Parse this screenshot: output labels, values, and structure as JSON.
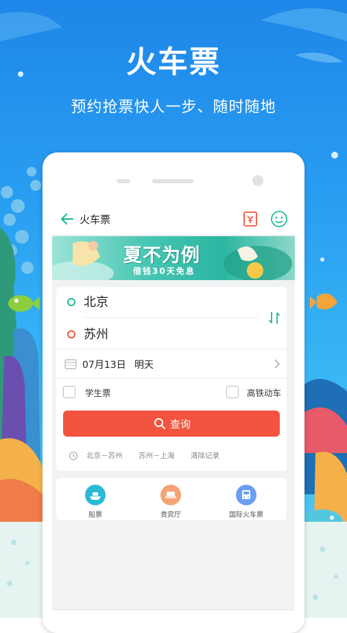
{
  "promo": {
    "title": "火车票",
    "subtitle": "预约抢票快人一步、随时随地"
  },
  "appbar": {
    "title": "火车票",
    "icons": [
      "back-arrow-icon",
      "ticket-icon",
      "customer-service-icon"
    ]
  },
  "banner": {
    "title": "夏不为例",
    "subtitle": "借钱30天免息"
  },
  "route": {
    "from": "北京",
    "to": "苏州",
    "from_color": "#1fb89a",
    "to_color": "#f3543f"
  },
  "date": {
    "value": "07月13日",
    "day": "明天"
  },
  "options": {
    "student": "学生票",
    "high_speed": "高铁动车"
  },
  "search": {
    "label": "查询",
    "color": "#f3543f"
  },
  "history": {
    "items": [
      "北京－苏州",
      "苏州－上海"
    ],
    "clear": "清除记录"
  },
  "services": [
    {
      "label": "船票",
      "color": "#2bb9d8",
      "icon": "ship-icon"
    },
    {
      "label": "贵宾厅",
      "color": "#f5a274",
      "icon": "lounge-icon"
    },
    {
      "label": "国际火车票",
      "color": "#6a9ef2",
      "icon": "international-train-icon"
    }
  ]
}
